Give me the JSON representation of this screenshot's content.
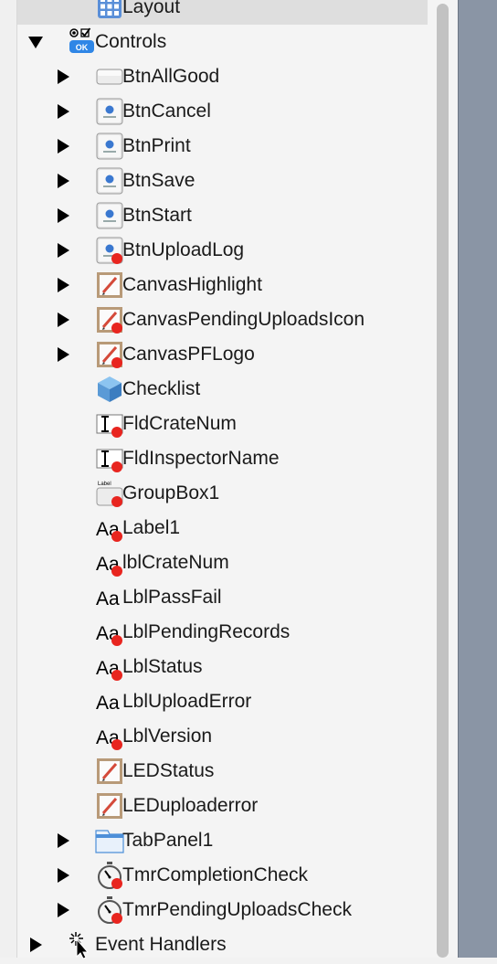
{
  "tree": {
    "items": [
      {
        "label": "Layout",
        "indent": 1,
        "disclosure": "none",
        "icon": "layout-grid-icon",
        "badge": false,
        "selected": true
      },
      {
        "label": "Controls",
        "indent": 0,
        "disclosure": "expanded",
        "icon": "controls-icon",
        "badge": false,
        "selected": false
      },
      {
        "label": "BtnAllGood",
        "indent": 1,
        "disclosure": "collapsed",
        "icon": "plain-button-icon",
        "badge": false,
        "selected": false
      },
      {
        "label": "BtnCancel",
        "indent": 1,
        "disclosure": "collapsed",
        "icon": "bevel-button-icon",
        "badge": false,
        "selected": false
      },
      {
        "label": "BtnPrint",
        "indent": 1,
        "disclosure": "collapsed",
        "icon": "bevel-button-icon",
        "badge": false,
        "selected": false
      },
      {
        "label": "BtnSave",
        "indent": 1,
        "disclosure": "collapsed",
        "icon": "bevel-button-icon",
        "badge": false,
        "selected": false
      },
      {
        "label": "BtnStart",
        "indent": 1,
        "disclosure": "collapsed",
        "icon": "bevel-button-icon",
        "badge": false,
        "selected": false
      },
      {
        "label": "BtnUploadLog",
        "indent": 1,
        "disclosure": "collapsed",
        "icon": "bevel-button-icon",
        "badge": true,
        "selected": false
      },
      {
        "label": "CanvasHighlight",
        "indent": 1,
        "disclosure": "collapsed",
        "icon": "canvas-icon",
        "badge": false,
        "selected": false
      },
      {
        "label": "CanvasPendingUploadsIcon",
        "indent": 1,
        "disclosure": "collapsed",
        "icon": "canvas-icon",
        "badge": true,
        "selected": false
      },
      {
        "label": "CanvasPFLogo",
        "indent": 1,
        "disclosure": "collapsed",
        "icon": "canvas-icon",
        "badge": true,
        "selected": false
      },
      {
        "label": "Checklist",
        "indent": 1,
        "disclosure": "none",
        "icon": "cube-icon",
        "badge": false,
        "selected": false
      },
      {
        "label": "FldCrateNum",
        "indent": 1,
        "disclosure": "none",
        "icon": "textfield-icon",
        "badge": true,
        "selected": false
      },
      {
        "label": "FldInspectorName",
        "indent": 1,
        "disclosure": "none",
        "icon": "textfield-icon",
        "badge": true,
        "selected": false
      },
      {
        "label": "GroupBox1",
        "indent": 1,
        "disclosure": "none",
        "icon": "groupbox-icon",
        "badge": true,
        "selected": false
      },
      {
        "label": "Label1",
        "indent": 1,
        "disclosure": "none",
        "icon": "label-aa-icon",
        "badge": true,
        "selected": false
      },
      {
        "label": "lblCrateNum",
        "indent": 1,
        "disclosure": "none",
        "icon": "label-aa-icon",
        "badge": true,
        "selected": false
      },
      {
        "label": "LblPassFail",
        "indent": 1,
        "disclosure": "none",
        "icon": "label-aa-icon",
        "badge": false,
        "selected": false
      },
      {
        "label": "LblPendingRecords",
        "indent": 1,
        "disclosure": "none",
        "icon": "label-aa-icon",
        "badge": true,
        "selected": false
      },
      {
        "label": "LblStatus",
        "indent": 1,
        "disclosure": "none",
        "icon": "label-aa-icon",
        "badge": true,
        "selected": false
      },
      {
        "label": "LblUploadError",
        "indent": 1,
        "disclosure": "none",
        "icon": "label-aa-icon",
        "badge": false,
        "selected": false
      },
      {
        "label": "LblVersion",
        "indent": 1,
        "disclosure": "none",
        "icon": "label-aa-icon",
        "badge": true,
        "selected": false
      },
      {
        "label": "LEDStatus",
        "indent": 1,
        "disclosure": "none",
        "icon": "canvas-icon",
        "badge": false,
        "selected": false
      },
      {
        "label": "LEDuploaderror",
        "indent": 1,
        "disclosure": "none",
        "icon": "canvas-icon",
        "badge": false,
        "selected": false
      },
      {
        "label": "TabPanel1",
        "indent": 1,
        "disclosure": "collapsed",
        "icon": "tabpanel-icon",
        "badge": false,
        "selected": false
      },
      {
        "label": "TmrCompletionCheck",
        "indent": 1,
        "disclosure": "collapsed",
        "icon": "timer-icon",
        "badge": true,
        "selected": false
      },
      {
        "label": "TmrPendingUploadsCheck",
        "indent": 1,
        "disclosure": "collapsed",
        "icon": "timer-icon",
        "badge": true,
        "selected": false
      },
      {
        "label": "Event Handlers",
        "indent": 0,
        "disclosure": "collapsed",
        "icon": "event-handlers-icon",
        "badge": false,
        "selected": false
      }
    ]
  },
  "colors": {
    "badge": "#e8251f",
    "right_pane": "#8a95a5",
    "selection": "#dedede"
  }
}
